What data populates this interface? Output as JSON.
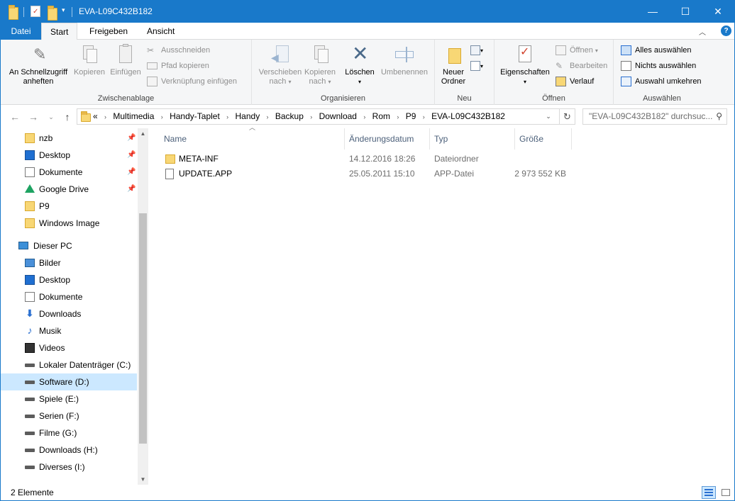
{
  "window": {
    "title": "EVA-L09C432B182",
    "controls": {
      "minimize": "—",
      "maximize": "☐",
      "close": "✕"
    }
  },
  "ribbon_tabs": [
    "Datei",
    "Start",
    "Freigeben",
    "Ansicht"
  ],
  "ribbon": {
    "zwischenablage": {
      "label": "Zwischenablage",
      "pin": "An Schnellzugriff anheften",
      "pin_line1": "An Schnellzugriff",
      "pin_line2": "anheften",
      "copy": "Kopieren",
      "paste": "Einfügen",
      "cut": "Ausschneiden",
      "copy_path": "Pfad kopieren",
      "paste_shortcut": "Verknüpfung einfügen"
    },
    "organisieren": {
      "label": "Organisieren",
      "move_line1": "Verschieben",
      "move_line2": "nach",
      "copyto_line1": "Kopieren",
      "copyto_line2": "nach",
      "delete": "Löschen",
      "rename": "Umbenennen"
    },
    "neu": {
      "label": "Neu",
      "new_folder_line1": "Neuer",
      "new_folder_line2": "Ordner"
    },
    "oeffnen": {
      "label": "Öffnen",
      "properties": "Eigenschaften",
      "open": "Öffnen",
      "edit": "Bearbeiten",
      "history": "Verlauf"
    },
    "auswaehlen": {
      "label": "Auswählen",
      "select_all": "Alles auswählen",
      "select_none": "Nichts auswählen",
      "invert": "Auswahl umkehren"
    }
  },
  "address": {
    "overflow": "«",
    "crumbs": [
      "Multimedia",
      "Handy-Taplet",
      "Handy",
      "Backup",
      "Download",
      "Rom",
      "P9",
      "EVA-L09C432B182"
    ],
    "search_placeholder": "\"EVA-L09C432B182\" durchsuc..."
  },
  "nav_pane": {
    "quick": [
      {
        "label": "nzb",
        "icon": "folder-icon",
        "pinned": true
      },
      {
        "label": "Desktop",
        "icon": "desktop-icon",
        "pinned": true
      },
      {
        "label": "Dokumente",
        "icon": "documents-icon",
        "pinned": true
      },
      {
        "label": "Google Drive",
        "icon": "google-drive-icon",
        "pinned": true
      },
      {
        "label": "P9",
        "icon": "folder-icon",
        "pinned": false
      },
      {
        "label": "Windows Image",
        "icon": "folder-icon",
        "pinned": false
      }
    ],
    "this_pc": "Dieser PC",
    "pc_items": [
      {
        "label": "Bilder",
        "icon": "pictures-icon"
      },
      {
        "label": "Desktop",
        "icon": "desktop-icon"
      },
      {
        "label": "Dokumente",
        "icon": "documents-icon"
      },
      {
        "label": "Downloads",
        "icon": "downloads-icon"
      },
      {
        "label": "Musik",
        "icon": "music-icon"
      },
      {
        "label": "Videos",
        "icon": "videos-icon"
      },
      {
        "label": "Lokaler Datenträger (C:)",
        "icon": "drive-icon"
      },
      {
        "label": "Software (D:)",
        "icon": "drive-icon",
        "selected": true
      },
      {
        "label": "Spiele (E:)",
        "icon": "drive-icon"
      },
      {
        "label": "Serien (F:)",
        "icon": "drive-icon"
      },
      {
        "label": "Filme (G:)",
        "icon": "drive-icon"
      },
      {
        "label": "Downloads (H:)",
        "icon": "drive-icon"
      },
      {
        "label": "Diverses (I:)",
        "icon": "drive-icon"
      }
    ]
  },
  "columns": {
    "name": "Name",
    "date": "Änderungsdatum",
    "type": "Typ",
    "size": "Größe"
  },
  "files": [
    {
      "name": "META-INF",
      "date": "14.12.2016 18:26",
      "type": "Dateiordner",
      "size": "",
      "icon": "folder-icon"
    },
    {
      "name": "UPDATE.APP",
      "date": "25.05.2011 15:10",
      "type": "APP-Datei",
      "size": "2 973 552 KB",
      "icon": "file-icon"
    }
  ],
  "status": {
    "count": "2 Elemente"
  }
}
